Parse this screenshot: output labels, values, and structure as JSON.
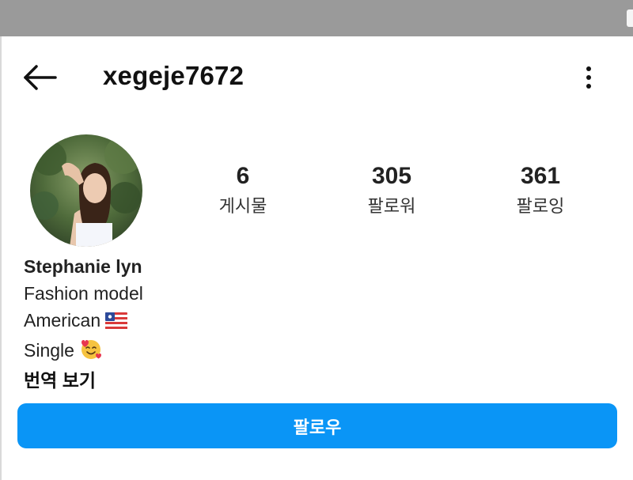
{
  "header": {
    "back_icon": "arrow-left-icon",
    "username": "xegeje7672",
    "more_icon": "more-vertical-icon"
  },
  "profile": {
    "avatar_icon": "profile-photo"
  },
  "stats": [
    {
      "value": "6",
      "label": "게시물"
    },
    {
      "value": "305",
      "label": "팔로워"
    },
    {
      "value": "361",
      "label": "팔로잉"
    }
  ],
  "bio": {
    "name": "Stephanie lyn",
    "line1": "Fashion model",
    "line2": "American",
    "line2_emoji": "flag-icon",
    "line3": "Single",
    "line3_emoji": "smiling-face-with-hearts-icon",
    "translate": "번역 보기"
  },
  "actions": {
    "follow_label": "팔로우"
  },
  "colors": {
    "accent": "#0a95f6",
    "status_bar": "#9a9a9a",
    "text": "#222222"
  }
}
